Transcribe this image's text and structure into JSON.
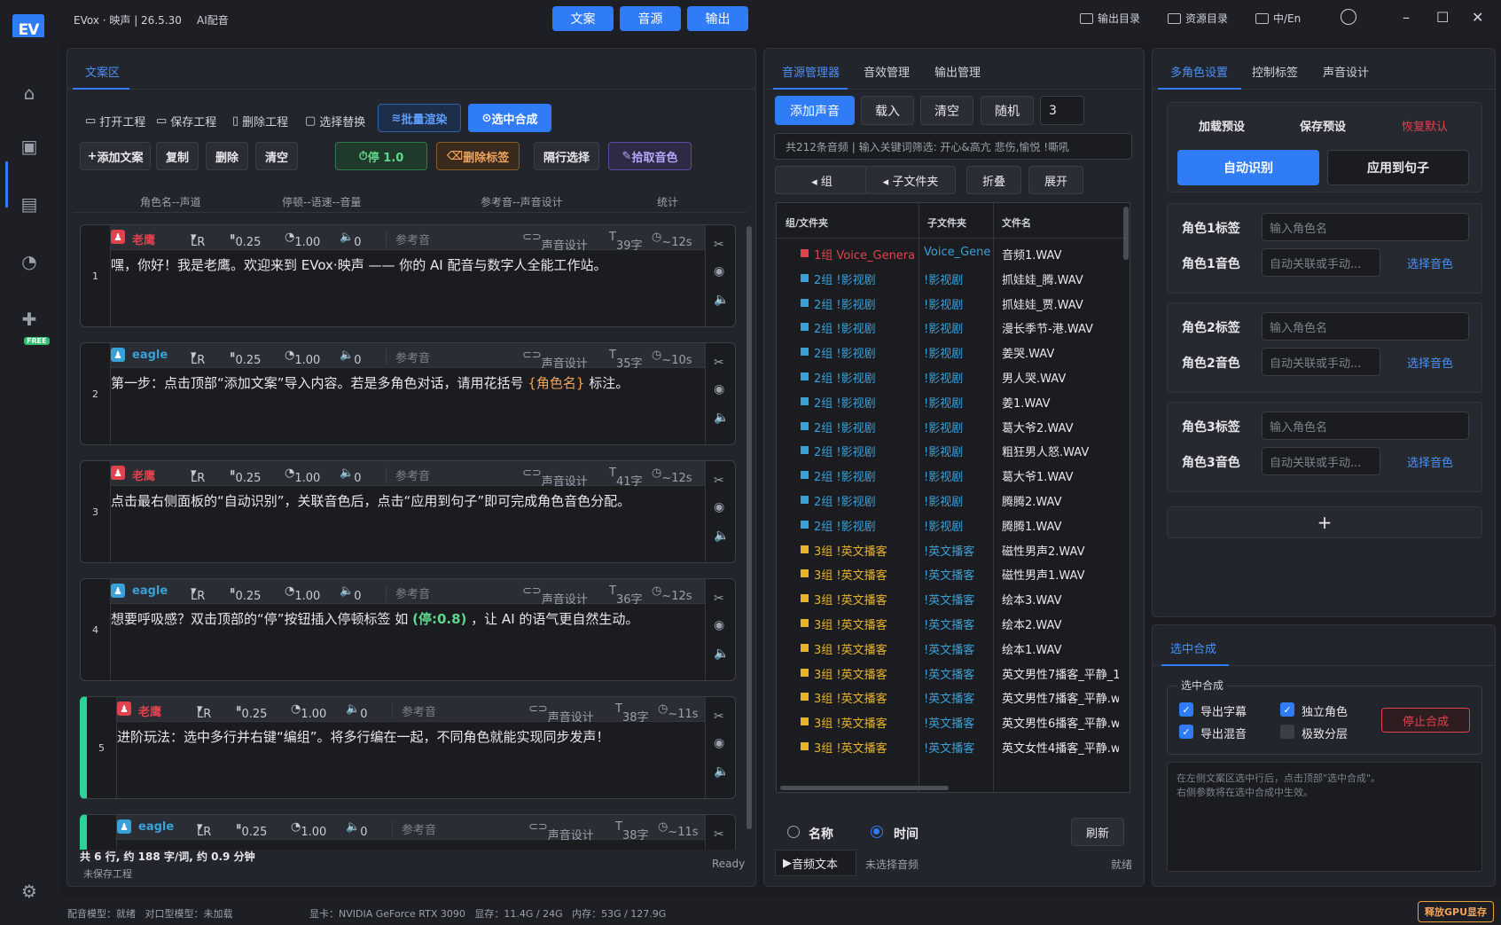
{
  "app": {
    "logo": "EV",
    "title": "EVox · 映声 | 26.5.30",
    "tag": "AI配音"
  },
  "nav": {
    "tabs": [
      "文案",
      "音源",
      "输出"
    ],
    "links": [
      "输出目录",
      "资源目录",
      "中/En"
    ]
  },
  "left": {
    "tab": "文案区",
    "toolbar1": [
      "打开工程",
      "保存工程",
      "删除工程",
      "选择替换"
    ],
    "batch_render": "批量渲染",
    "select_synth": "选中合成",
    "toolbar2": {
      "add": "添加文案",
      "copy": "复制",
      "delete": "删除",
      "clear": "清空",
      "pause": "停 1.0",
      "remove_tags": "删除标签",
      "alt_select": "隔行选择",
      "pick_voice": "拾取音色"
    },
    "columns": [
      "角色名--声道",
      "停顿--语速--音量",
      "参考音--声音设计",
      "统计"
    ],
    "cards": [
      {
        "num": "1",
        "role": "老鹰",
        "color": "#e0424e",
        "lr": "LR",
        "pause": "0.25",
        "speed": "1.00",
        "vol": "0",
        "ref": "参考音",
        "design": "声音设计",
        "count": "39字",
        "dur": "~12s",
        "text": "嘿，你好！我是老鹰。欢迎来到 EVox·映声 —— 你的 AI 配音与数字人全能工作站。"
      },
      {
        "num": "2",
        "role": "eagle",
        "color": "#3aa0d8",
        "lr": "LR",
        "pause": "0.25",
        "speed": "1.00",
        "vol": "0",
        "ref": "参考音",
        "design": "声音设计",
        "count": "35字",
        "dur": "~10s",
        "text_a": "第一步：点击顶部“添加文案”导入内容。若是多角色对话，请用花括号 ",
        "hl": "{角色名}",
        "text_b": " 标注。"
      },
      {
        "num": "3",
        "role": "老鹰",
        "color": "#e0424e",
        "lr": "LR",
        "pause": "0.25",
        "speed": "1.00",
        "vol": "0",
        "ref": "参考音",
        "design": "声音设计",
        "count": "41字",
        "dur": "~12s",
        "text": "点击最右侧面板的“自动识别”，关联音色后，点击“应用到句子”即可完成角色音色分配。"
      },
      {
        "num": "4",
        "role": "eagle",
        "color": "#3aa0d8",
        "lr": "LR",
        "pause": "0.25",
        "speed": "1.00",
        "vol": "0",
        "ref": "参考音",
        "design": "声音设计",
        "count": "36字",
        "dur": "~12s",
        "text_a": "想要呼吸感？双击顶部的“停”按钮插入停顿标签 如 ",
        "hl": "(停:0.8)",
        "text_b": " ，让 AI 的语气更自然生动。"
      },
      {
        "num": "5",
        "role": "老鹰",
        "color": "#e0424e",
        "lr": "LR",
        "pause": "0.25",
        "speed": "1.00",
        "vol": "0",
        "ref": "参考音",
        "design": "声音设计",
        "count": "38字",
        "dur": "~11s",
        "text": "进阶玩法：选中多行并右键“编组”。将多行编在一起，不同角色就能实现同步发声！"
      },
      {
        "num": "6",
        "role": "eagle",
        "color": "#3aa0d8",
        "lr": "LR",
        "pause": "0.25",
        "speed": "1.00",
        "vol": "0",
        "ref": "参考音",
        "design": "声音设计",
        "count": "38字",
        "dur": "~11s",
        "text": ""
      }
    ],
    "footer": {
      "summary": "共 6 行, 约 188 字/词, 约 0.9 分钟",
      "project": "未保存工程",
      "status": "Ready"
    }
  },
  "middle": {
    "tabs": [
      "音源管理器",
      "音效管理",
      "输出管理"
    ],
    "actions": {
      "add": "添加声音",
      "load": "载入",
      "clear": "清空",
      "random": "随机",
      "count": "3"
    },
    "search_placeholder": "共212条音频 | 输入关键词筛选: 开心&高亢 悲伤,愉悦 !嘶吼",
    "group_btns": [
      "◂ 组",
      "◂ 子文件夹",
      "折叠",
      "展开"
    ],
    "headers": [
      "组/文件夹",
      "子文件夹",
      "文件名"
    ],
    "rows": [
      {
        "g": "1组  Voice_Genera",
        "s": "Voice_Gene",
        "f": "音频1.WAV",
        "c": "#e0424e"
      },
      {
        "g": "2组  !影视剧",
        "s": "!影视剧",
        "f": "抓娃娃_腾.WAV",
        "c": "#3aa0d8"
      },
      {
        "g": "2组  !影视剧",
        "s": "!影视剧",
        "f": "抓娃娃_贾.WAV",
        "c": "#3aa0d8"
      },
      {
        "g": "2组  !影视剧",
        "s": "!影视剧",
        "f": "漫长季节-港.WAV",
        "c": "#3aa0d8"
      },
      {
        "g": "2组  !影视剧",
        "s": "!影视剧",
        "f": "姜哭.WAV",
        "c": "#3aa0d8"
      },
      {
        "g": "2组  !影视剧",
        "s": "!影视剧",
        "f": "男人哭.WAV",
        "c": "#3aa0d8"
      },
      {
        "g": "2组  !影视剧",
        "s": "!影视剧",
        "f": "姜1.WAV",
        "c": "#3aa0d8"
      },
      {
        "g": "2组  !影视剧",
        "s": "!影视剧",
        "f": "葛大爷2.WAV",
        "c": "#3aa0d8"
      },
      {
        "g": "2组  !影视剧",
        "s": "!影视剧",
        "f": "粗狂男人怒.WAV",
        "c": "#3aa0d8"
      },
      {
        "g": "2组  !影视剧",
        "s": "!影视剧",
        "f": "葛大爷1.WAV",
        "c": "#3aa0d8"
      },
      {
        "g": "2组  !影视剧",
        "s": "!影视剧",
        "f": "腾腾2.WAV",
        "c": "#3aa0d8"
      },
      {
        "g": "2组  !影视剧",
        "s": "!影视剧",
        "f": "腾腾1.WAV",
        "c": "#3aa0d8"
      },
      {
        "g": "3组  !英文播客",
        "s": "!英文播客",
        "f": "磁性男声2.WAV",
        "c": "#e8b42a"
      },
      {
        "g": "3组  !英文播客",
        "s": "!英文播客",
        "f": "磁性男声1.WAV",
        "c": "#e8b42a"
      },
      {
        "g": "3组  !英文播客",
        "s": "!英文播客",
        "f": "绘本3.WAV",
        "c": "#e8b42a"
      },
      {
        "g": "3组  !英文播客",
        "s": "!英文播客",
        "f": "绘本2.WAV",
        "c": "#e8b42a"
      },
      {
        "g": "3组  !英文播客",
        "s": "!英文播客",
        "f": "绘本1.WAV",
        "c": "#e8b42a"
      },
      {
        "g": "3组  !英文播客",
        "s": "!英文播客",
        "f": "英文男性7播客_平静_1",
        "c": "#e8b42a"
      },
      {
        "g": "3组  !英文播客",
        "s": "!英文播客",
        "f": "英文男性7播客_平静.w",
        "c": "#e8b42a"
      },
      {
        "g": "3组  !英文播客",
        "s": "!英文播客",
        "f": "英文男性6播客_平静.w",
        "c": "#e8b42a"
      },
      {
        "g": "3组  !英文播客",
        "s": "!英文播客",
        "f": "英文女性4播客_平静.w",
        "c": "#e8b42a"
      }
    ],
    "sort": {
      "name": "名称",
      "time": "时间",
      "refresh": "刷新"
    },
    "bottom": {
      "audio_text": "音频文本",
      "none": "未选择音频",
      "ready": "就绪"
    }
  },
  "right": {
    "tabs": [
      "多角色设置",
      "控制标签",
      "声音设计"
    ],
    "preset": {
      "load": "加载预设",
      "save": "保存预设",
      "reset": "恢复默认"
    },
    "auto": "自动识别",
    "apply": "应用到句子",
    "roles": [
      {
        "tag_label": "角色1标签",
        "tag_ph": "输入角色名",
        "voice_label": "角色1音色",
        "voice_ph": "自动关联或手动...",
        "pick": "选择音色"
      },
      {
        "tag_label": "角色2标签",
        "tag_ph": "输入角色名",
        "voice_label": "角色2音色",
        "voice_ph": "自动关联或手动...",
        "pick": "选择音色"
      },
      {
        "tag_label": "角色3标签",
        "tag_ph": "输入角色名",
        "voice_label": "角色3音色",
        "voice_ph": "自动关联或手动...",
        "pick": "选择音色"
      }
    ],
    "add": "+",
    "synth": {
      "tab": "选中合成",
      "group": "选中合成",
      "opts": [
        "导出字幕",
        "独立角色",
        "导出混音",
        "极致分层"
      ],
      "stop": "停止合成",
      "hint1": "在左侧文案区选中行后，点击顶部\"选中合成\"。",
      "hint2": "右侧参数将在选中合成中生效。"
    }
  },
  "status": {
    "left": "配音模型：就绪   对口型模型：未加载",
    "gpu": "显卡：NVIDIA GeForce RTX 3090   显存：11.4G / 24G   内存：53G / 127.9G",
    "release": "释放GPU显存"
  }
}
